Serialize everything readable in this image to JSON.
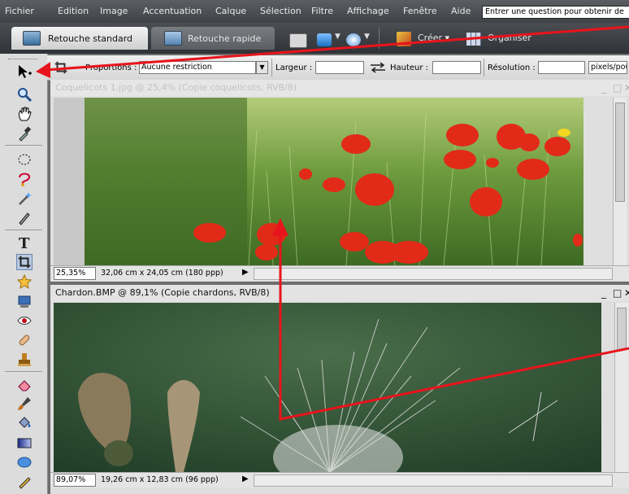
{
  "menu": {
    "items": [
      "Fichier",
      "Edition",
      "Image",
      "Accentuation",
      "Calque",
      "Sélection",
      "Filtre",
      "Affichage",
      "Fenêtre",
      "Aide"
    ],
    "help_placeholder": "Entrer une question pour obtenir de"
  },
  "modebar": {
    "tab_standard": "Retouche standard",
    "tab_fast": "Retouche rapide",
    "create_label": "Créer ▾",
    "organize_label": "Organiser"
  },
  "options": {
    "proportions_label": "Proportions :",
    "proportions_value": "Aucune restriction",
    "width_label": "Largeur :",
    "height_label": "Hauteur :",
    "resolution_label": "Résolution :",
    "resolution_unit": "pixels/pou"
  },
  "doc1": {
    "title": "Coquelicots 1.jpg @ 25,4% (Copie coquelicots, RVB/8)",
    "zoom": "25,35%",
    "dimensions": "32,06 cm x 24,05 cm (180 ppp)"
  },
  "doc2": {
    "title": "Chardon.BMP @ 89,1% (Copie chardons, RVB/8)",
    "zoom": "89,07%",
    "dimensions": "19,26 cm x 12,83 cm (96 ppp)"
  },
  "colors": {
    "annotation": "#e8141c",
    "menubar": "#4a4d52",
    "toolbox": "#dcdcdc"
  }
}
